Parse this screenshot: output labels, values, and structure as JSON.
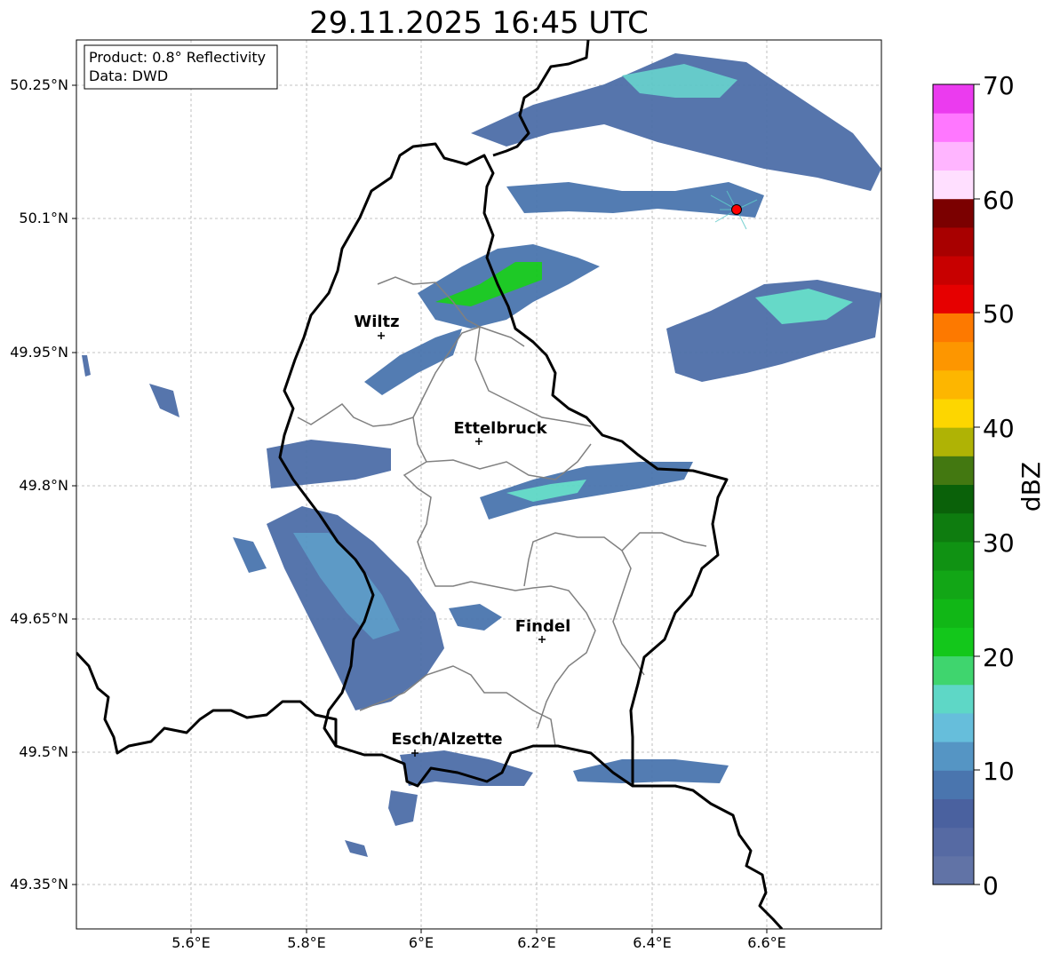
{
  "title": "29.11.2025 16:45 UTC",
  "info_box": {
    "product": "Product: 0.8° Reflectivity",
    "data": "Data: DWD"
  },
  "colorbar": {
    "label": "dBZ",
    "ticks": [
      "0",
      "10",
      "20",
      "30",
      "40",
      "50",
      "60",
      "70"
    ],
    "colors": [
      "#6173a6",
      "#566aa3",
      "#4a619f",
      "#4a75ae",
      "#5595c4",
      "#66bedb",
      "#5ed7c6",
      "#3fd56e",
      "#13c71b",
      "#11b716",
      "#12a616",
      "#109213",
      "#0e7c0f",
      "#0a6109",
      "#437811",
      "#afb305",
      "#fdd600",
      "#fdb600",
      "#fd9600",
      "#fd7900",
      "#e60000",
      "#c80000",
      "#a80000",
      "#7b0000",
      "#ffdfff",
      "#ffb5ff",
      "#ff77ff",
      "#eb3bef"
    ]
  },
  "axes": {
    "lon_ticks": [
      "5.6°E",
      "5.8°E",
      "6°E",
      "6.2°E",
      "6.4°E",
      "6.6°E"
    ],
    "lat_ticks": [
      "50.25°N",
      "50.1°N",
      "49.95°N",
      "49.8°N",
      "49.65°N",
      "49.5°N",
      "49.35°N"
    ]
  },
  "cities": [
    {
      "name": "Wiltz"
    },
    {
      "name": "Ettelbruck"
    },
    {
      "name": "Findel"
    },
    {
      "name": "Esch/Alzette"
    }
  ],
  "radar_site_color": "#ff0000"
}
